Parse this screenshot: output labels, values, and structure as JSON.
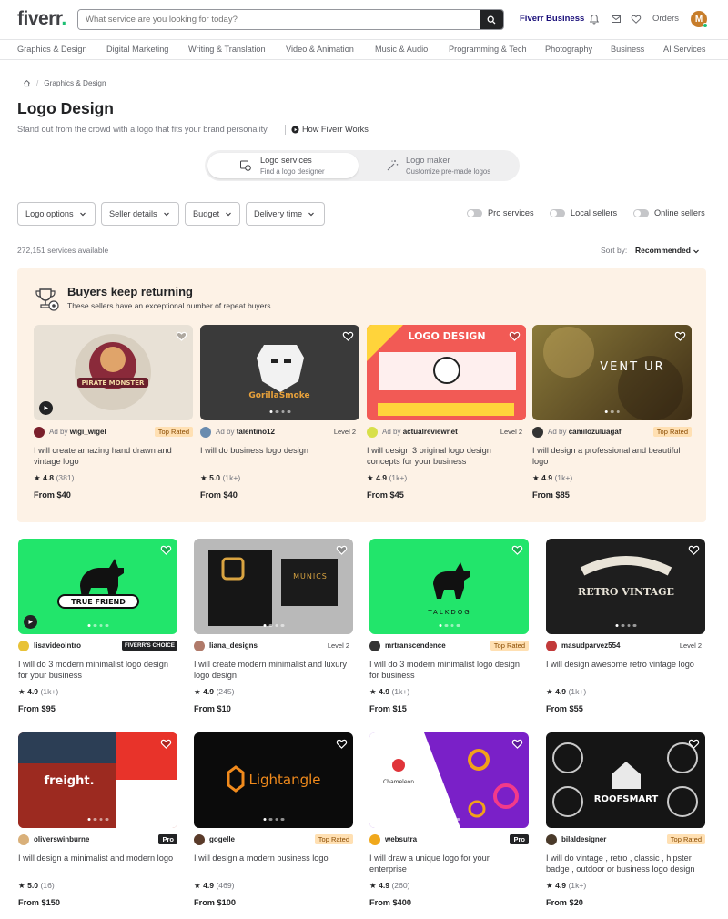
{
  "header": {
    "logo": "fiverr",
    "logo_dot": ".",
    "search_placeholder": "What service are you looking for today?",
    "fiverr_business": "Fiverr Business",
    "orders": "Orders",
    "avatar_initial": "M"
  },
  "categories": [
    "Graphics & Design",
    "Digital Marketing",
    "Writing & Translation",
    "Video & Animation",
    "Music & Audio",
    "Programming & Tech",
    "Photography",
    "Business",
    "AI Services"
  ],
  "breadcrumb": {
    "sep": "/",
    "item": "Graphics & Design"
  },
  "page": {
    "title": "Logo Design",
    "subtitle": "Stand out from the crowd with a logo that fits your brand personality.",
    "how_works": "How Fiverr Works"
  },
  "toggle": {
    "services_title": "Logo services",
    "services_sub": "Find a logo designer",
    "maker_title": "Logo maker",
    "maker_sub": "Customize pre-made logos"
  },
  "filters": [
    "Logo options",
    "Seller details",
    "Budget",
    "Delivery time"
  ],
  "switches": [
    "Pro services",
    "Local sellers",
    "Online sellers"
  ],
  "results": {
    "count": "272,151 services available",
    "sort_label": "Sort by:",
    "sort_value": "Recommended"
  },
  "promo": {
    "title": "Buyers keep returning",
    "subtitle": "These sellers have an exceptional number of repeat buyers."
  },
  "promo_gigs": [
    {
      "ad_prefix": "Ad by",
      "seller": "wigi_wigel",
      "badge": "Top Rated",
      "title": "I will create amazing hand drawn and vintage logo",
      "rating": "4.8",
      "count": "(381)",
      "price": "From $40",
      "thumb_text": "PIRATE MONSTER",
      "accent": "#e8e1d6"
    },
    {
      "ad_prefix": "Ad by",
      "seller": "talentino12",
      "badge": "Level 2",
      "title": "I will do business logo design",
      "rating": "5.0",
      "count": "(1k+)",
      "price": "From $40",
      "thumb_text": "GorillaSmoke",
      "accent": "#3a3a3a"
    },
    {
      "ad_prefix": "Ad by",
      "seller": "actualreviewnet",
      "badge": "Level 2",
      "title": "I will design 3 original logo design concepts for your business",
      "rating": "4.9",
      "count": "(1k+)",
      "price": "From $45",
      "thumb_text": "LOGO DESIGN",
      "accent": "#f0504f"
    },
    {
      "ad_prefix": "Ad by",
      "seller": "camilozuluagaf",
      "badge": "Top Rated",
      "title": "I will design a professional and beautiful logo",
      "rating": "4.9",
      "count": "(1k+)",
      "price": "From $85",
      "thumb_text": "VENT UR",
      "accent": "#6e5a2a"
    }
  ],
  "gigs": [
    {
      "seller": "lisavideointro",
      "badge": "FIVERR'S CHOICE",
      "title": "I will do 3 modern minimalist logo design for your business",
      "rating": "4.9",
      "count": "(1k+)",
      "price": "From $95",
      "thumb_text": "TRUE FRIEND",
      "accent": "#22e56b"
    },
    {
      "seller": "liana_designs",
      "badge": "Level 2",
      "title": "I will create modern minimalist and luxury logo design",
      "rating": "4.9",
      "count": "(245)",
      "price": "From $10",
      "thumb_text": "MUNICS",
      "accent": "#9a9a9a"
    },
    {
      "seller": "mrtranscendence",
      "badge": "Top Rated",
      "title": "I will do 3 modern minimalist logo design for business",
      "rating": "4.9",
      "count": "(1k+)",
      "price": "From $15",
      "thumb_text": "TALKDOG",
      "accent": "#22e56b"
    },
    {
      "seller": "masudparvez554",
      "badge": "Level 2",
      "title": "I will design awesome retro vintage logo",
      "rating": "4.9",
      "count": "(1k+)",
      "price": "From $55",
      "thumb_text": "RETRO VINTAGE",
      "accent": "#1e1e1e"
    },
    {
      "seller": "oliverswinburne",
      "badge": "Pro",
      "title": "I will design a minimalist and modern logo",
      "rating": "5.0",
      "count": "(16)",
      "price": "From $150",
      "thumb_text": "freight.",
      "accent": "#e8332a"
    },
    {
      "seller": "gogelle",
      "badge": "Top Rated",
      "title": "I will design a modern business logo",
      "rating": "4.9",
      "count": "(469)",
      "price": "From $100",
      "thumb_text": "Lightangle",
      "accent": "#0b0b0b"
    },
    {
      "seller": "websutra",
      "badge": "Pro",
      "title": "I will draw a unique logo for your enterprise",
      "rating": "4.9",
      "count": "(260)",
      "price": "From $400",
      "thumb_text": "Chameleon",
      "accent": "#7a20c8"
    },
    {
      "seller": "bilaldesigner",
      "badge": "Top Rated",
      "title": "I will do vintage , retro , classic , hipster badge , outdoor or business logo design",
      "rating": "4.9",
      "count": "(1k+)",
      "price": "From $20",
      "thumb_text": "ROOFSMART",
      "accent": "#151515"
    }
  ]
}
